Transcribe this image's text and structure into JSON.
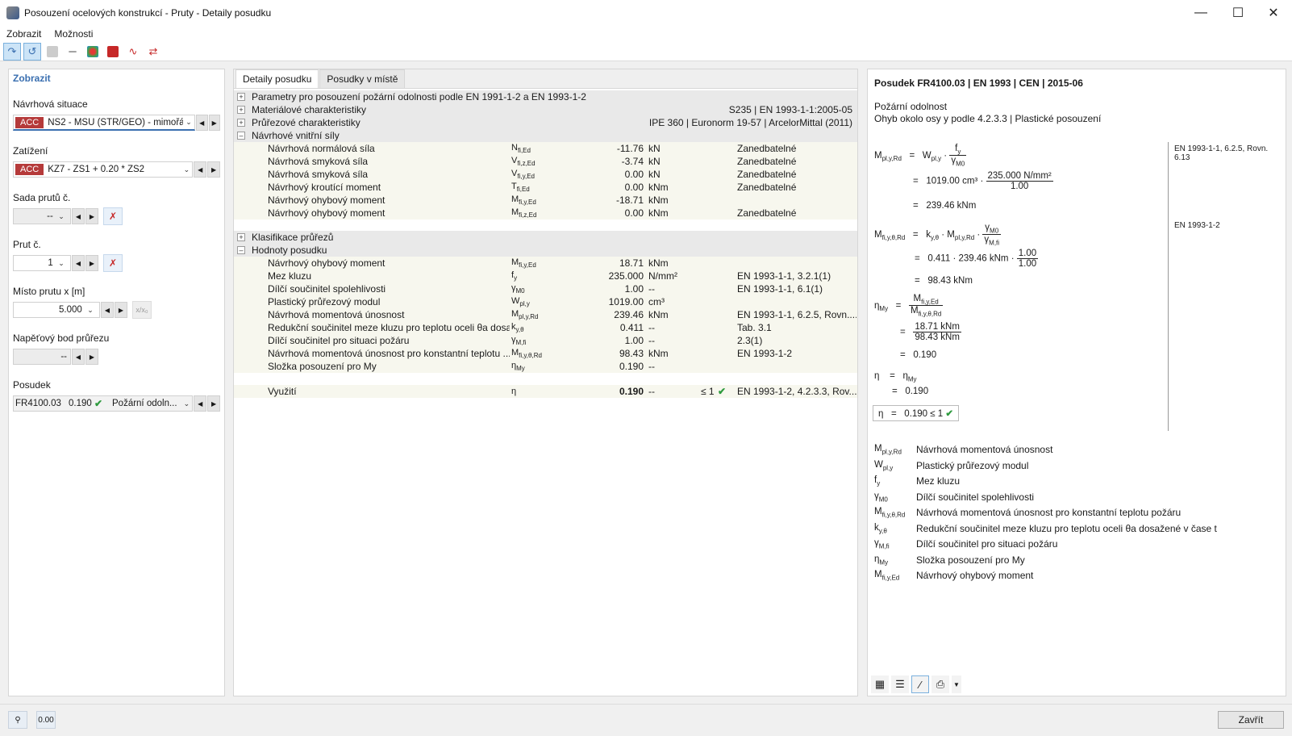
{
  "window": {
    "title": "Posouzení ocelových konstrukcí - Pruty - Detaily posudku"
  },
  "menu": [
    "Zobrazit",
    "Možnosti"
  ],
  "left": {
    "header": "Zobrazit",
    "design_situation": {
      "label": "Návrhová situace",
      "tag": "ACC",
      "value": "NS2 - MSÚ (STR/GEO) - mimořá..."
    },
    "load": {
      "label": "Zatížení",
      "tag": "ACC",
      "value": "KZ7 - ZS1 + 0.20 * ZS2"
    },
    "member_set": {
      "label": "Sada prutů č.",
      "value": "--"
    },
    "member": {
      "label": "Prut č.",
      "value": "1"
    },
    "location": {
      "label": "Místo prutu x [m]",
      "value": "5.000",
      "rel_btn": "x/x₀"
    },
    "stress_point": {
      "label": "Napěťový bod průřezu",
      "value": "--"
    },
    "check": {
      "label": "Posudek",
      "id": "FR4100.03",
      "ratio": "0.190",
      "type": "Požární odoln..."
    }
  },
  "center": {
    "tabs": [
      "Detaily posudku",
      "Posudky v místě"
    ],
    "sections": {
      "params": {
        "label": "Parametry pro posouzení požární odolnosti podle EN 1991-1-2 a EN 1993-1-2"
      },
      "material": {
        "label": "Materiálové charakteristiky",
        "value": "S235 | EN 1993-1-1:2005-05"
      },
      "section": {
        "label": "Průřezové charakteristiky",
        "value": "IPE 360 | Euronorm 19-57 | ArcelorMittal (2011)"
      },
      "forces": {
        "label": "Návrhové vnitřní síly"
      },
      "classification": {
        "label": "Klasifikace průřezů"
      },
      "values": {
        "label": "Hodnoty posudku"
      }
    },
    "force_rows": [
      {
        "name": "Návrhová normálová síla",
        "sym": "N",
        "sub": "fi,Ed",
        "val": "-11.76",
        "unit": "kN",
        "note": "Zanedbatelné"
      },
      {
        "name": "Návrhová smyková síla",
        "sym": "V",
        "sub": "fi,z,Ed",
        "val": "-3.74",
        "unit": "kN",
        "note": "Zanedbatelné"
      },
      {
        "name": "Návrhová smyková síla",
        "sym": "V",
        "sub": "fi,y,Ed",
        "val": "0.00",
        "unit": "kN",
        "note": "Zanedbatelné"
      },
      {
        "name": "Návrhový kroutící moment",
        "sym": "T",
        "sub": "fi,Ed",
        "val": "0.00",
        "unit": "kNm",
        "note": "Zanedbatelné"
      },
      {
        "name": "Návrhový ohybový moment",
        "sym": "M",
        "sub": "fi,y,Ed",
        "val": "-18.71",
        "unit": "kNm",
        "note": ""
      },
      {
        "name": "Návrhový ohybový moment",
        "sym": "M",
        "sub": "fi,z,Ed",
        "val": "0.00",
        "unit": "kNm",
        "note": "Zanedbatelné"
      }
    ],
    "value_rows": [
      {
        "name": "Návrhový ohybový moment",
        "sym": "M",
        "sub": "fi,y,Ed",
        "val": "18.71",
        "unit": "kNm",
        "note": ""
      },
      {
        "name": "Mez kluzu",
        "sym": "f",
        "sub": "y",
        "val": "235.000",
        "unit": "N/mm²",
        "note": "EN 1993-1-1, 3.2.1(1)"
      },
      {
        "name": "Dílčí součinitel spolehlivosti",
        "sym": "γ",
        "sub": "M0",
        "val": "1.00",
        "unit": "--",
        "note": "EN 1993-1-1, 6.1(1)"
      },
      {
        "name": "Plastický průřezový modul",
        "sym": "W",
        "sub": "pl,y",
        "val": "1019.00",
        "unit": "cm³",
        "note": ""
      },
      {
        "name": "Návrhová momentová únosnost",
        "sym": "M",
        "sub": "pl,y,Rd",
        "val": "239.46",
        "unit": "kNm",
        "note": "EN 1993-1-1, 6.2.5, Rovn...."
      },
      {
        "name": "Redukční součinitel meze kluzu pro teplotu oceli θa dosaže...",
        "sym": "k",
        "sub": "y,θ",
        "val": "0.411",
        "unit": "--",
        "note": "Tab. 3.1"
      },
      {
        "name": "Dílčí součinitel pro situaci požáru",
        "sym": "γ",
        "sub": "M,fi",
        "val": "1.00",
        "unit": "--",
        "note": "2.3(1)"
      },
      {
        "name": "Návrhová momentová únosnost pro konstantní teplotu ...",
        "sym": "M",
        "sub": "fi,y,θ,Rd",
        "val": "98.43",
        "unit": "kNm",
        "note": "EN 1993-1-2"
      },
      {
        "name": "Složka posouzení pro My",
        "sym": "η",
        "sub": "My",
        "val": "0.190",
        "unit": "--",
        "note": ""
      }
    ],
    "utilization": {
      "name": "Využití",
      "sym": "η",
      "val": "0.190",
      "unit": "--",
      "limit": "≤ 1",
      "note": "EN 1993-1-2, 4.2.3.3, Rov..."
    }
  },
  "right": {
    "title": "Posudek FR4100.03 | EN 1993 | CEN | 2015-06",
    "sub1": "Požární odolnost",
    "sub2": "Ohyb okolo osy y podle 4.2.3.3 | Plastické posouzení",
    "ref1": "EN 1993-1-1, 6.2.5, Rovn. 6.13",
    "ref2": "EN 1993-1-2",
    "eq": {
      "w_val": "1019.00",
      "w_unit": "cm³",
      "fy_val": "235.000 N/mm²",
      "gm0_val": "1.00",
      "mplrd": "239.46 kNm",
      "ky": "0.411",
      "gmfi_val": "1.00",
      "mfi": "98.43 kNm",
      "med": "18.71 kNm",
      "eta": "0.190",
      "limit": "≤ 1"
    },
    "legend": [
      {
        "sym": "M",
        "sub": "pl,y,Rd",
        "text": "Návrhová momentová únosnost"
      },
      {
        "sym": "W",
        "sub": "pl,y",
        "text": "Plastický průřezový modul"
      },
      {
        "sym": "f",
        "sub": "y",
        "text": "Mez kluzu"
      },
      {
        "sym": "γ",
        "sub": "M0",
        "text": "Dílčí součinitel spolehlivosti"
      },
      {
        "sym": "M",
        "sub": "fi,y,θ,Rd",
        "text": "Návrhová momentová únosnost pro konstantní teplotu požáru"
      },
      {
        "sym": "k",
        "sub": "y,θ",
        "text": "Redukční součinitel meze kluzu pro teplotu oceli θa dosažené v čase t"
      },
      {
        "sym": "γ",
        "sub": "M,fi",
        "text": "Dílčí součinitel pro situaci požáru"
      },
      {
        "sym": "η",
        "sub": "My",
        "text": "Složka posouzení pro My"
      },
      {
        "sym": "M",
        "sub": "fi,y,Ed",
        "text": "Návrhový ohybový moment"
      }
    ]
  },
  "footer": {
    "close_label": "Zavřít",
    "decimals_label": "0.00"
  }
}
